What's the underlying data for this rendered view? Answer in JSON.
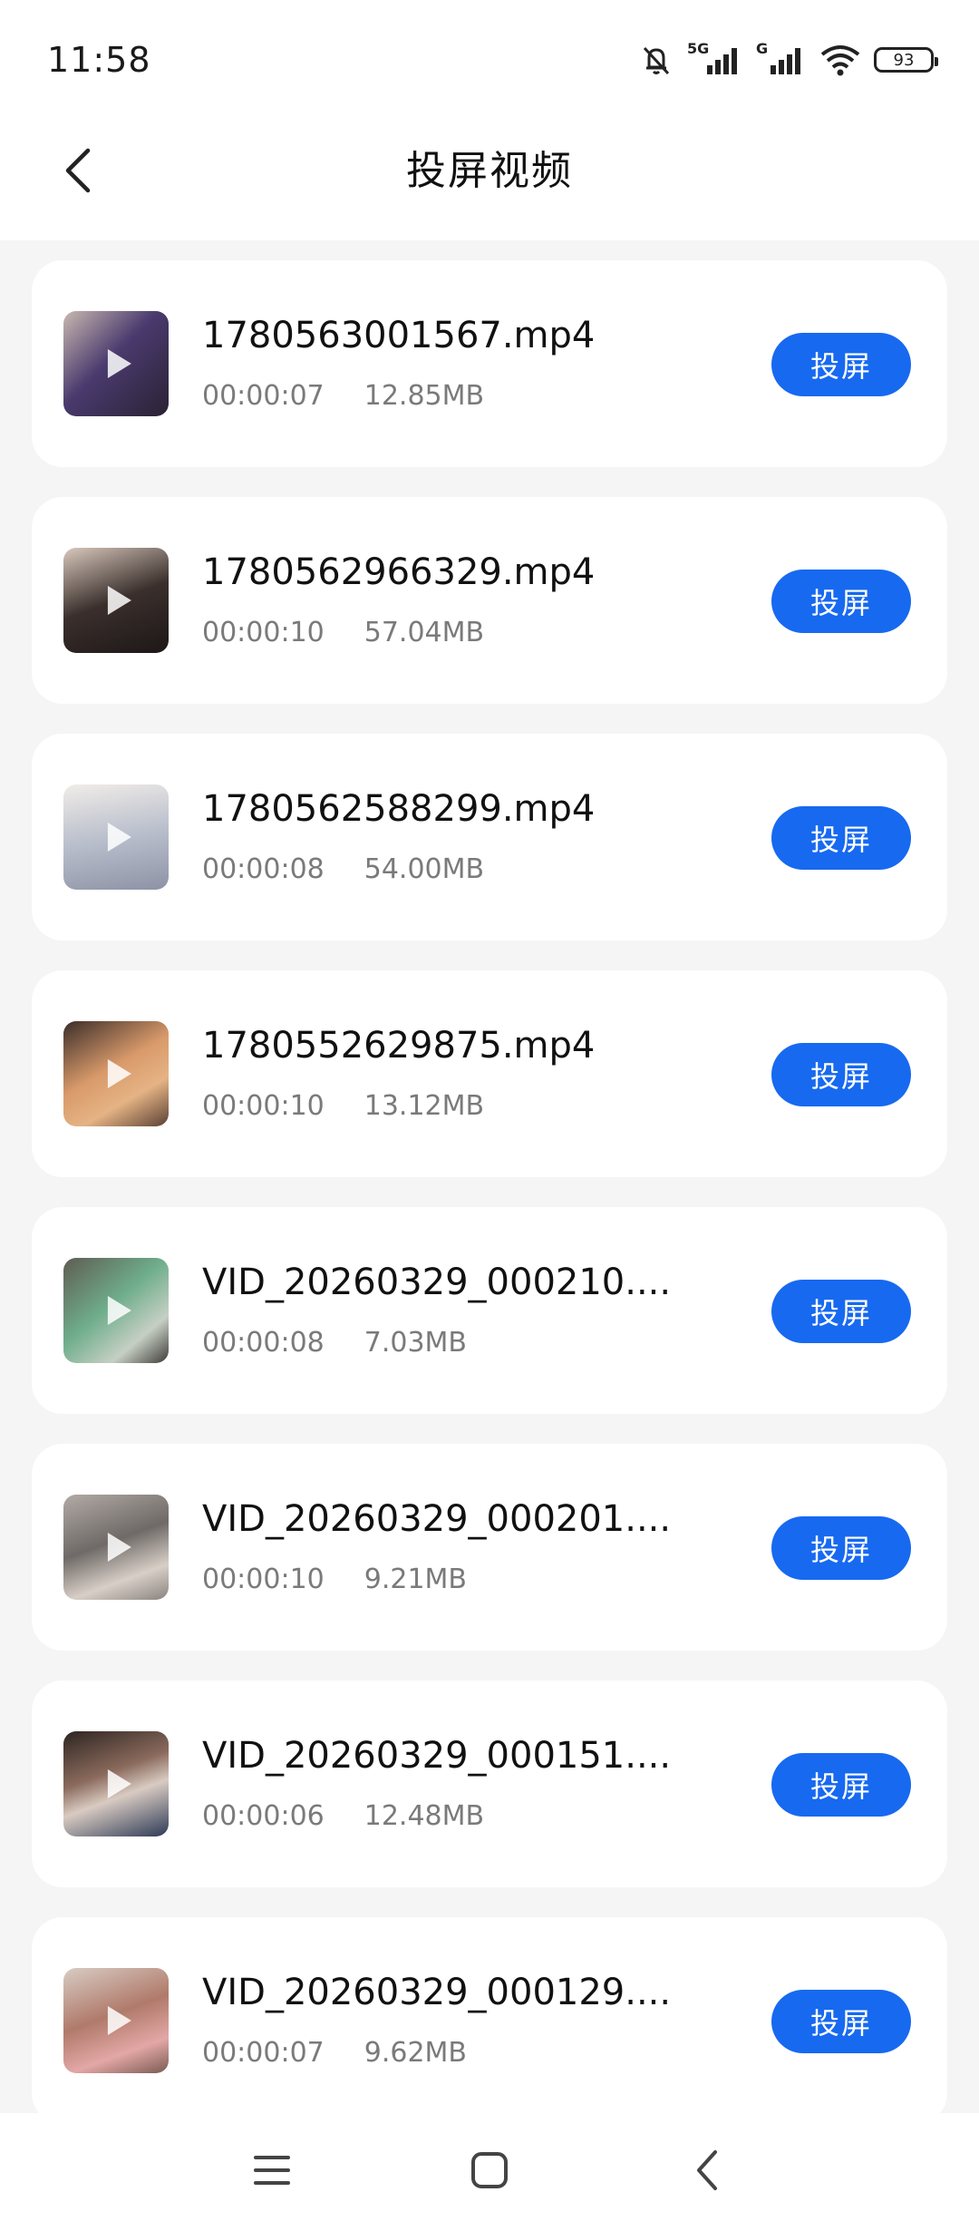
{
  "status_bar": {
    "time": "11:58",
    "icons": [
      "bell-muted-icon",
      "5g-signal-icon",
      "g-signal-icon",
      "wifi-icon",
      "battery-icon"
    ],
    "network_5g_label": "5G",
    "network_g_label": "G",
    "battery_level": "93"
  },
  "header": {
    "title": "投屏视频",
    "back_icon": "chevron-left-icon"
  },
  "videos": [
    {
      "name": "1780563001567.mp4",
      "duration": "00:00:07",
      "size": "12.85MB",
      "action": "投屏"
    },
    {
      "name": "1780562966329.mp4",
      "duration": "00:00:10",
      "size": "57.04MB",
      "action": "投屏"
    },
    {
      "name": "1780562588299.mp4",
      "duration": "00:00:08",
      "size": "54.00MB",
      "action": "投屏"
    },
    {
      "name": "1780552629875.mp4",
      "duration": "00:00:10",
      "size": "13.12MB",
      "action": "投屏"
    },
    {
      "name": "VID_20260329_000210....",
      "duration": "00:00:08",
      "size": "7.03MB",
      "action": "投屏"
    },
    {
      "name": "VID_20260329_000201....",
      "duration": "00:00:10",
      "size": "9.21MB",
      "action": "投屏"
    },
    {
      "name": "VID_20260329_000151....",
      "duration": "00:00:06",
      "size": "12.48MB",
      "action": "投屏"
    },
    {
      "name": "VID_20260329_000129....",
      "duration": "00:00:07",
      "size": "9.62MB",
      "action": "投屏"
    }
  ],
  "colors": {
    "accent": "#1769f0",
    "background": "#f5f5f5",
    "card": "#ffffff"
  },
  "nav_bar": {
    "icons": [
      "menu-icon",
      "home-square-icon",
      "back-triangle-icon"
    ]
  }
}
